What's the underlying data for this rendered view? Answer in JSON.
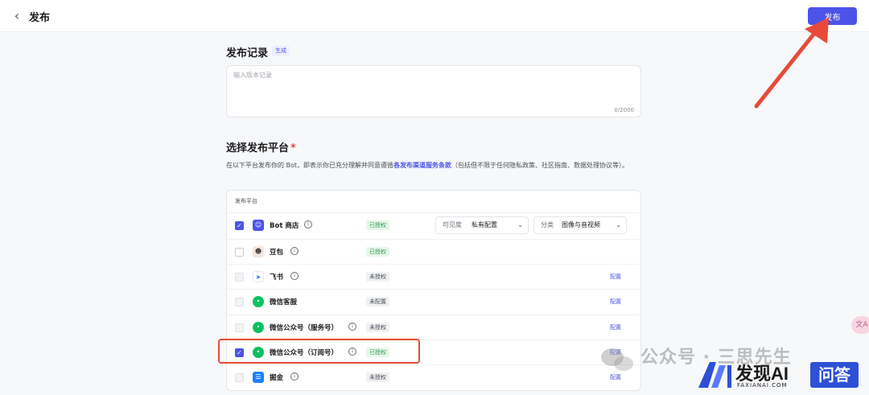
{
  "header": {
    "back_icon": "chevron-left-icon",
    "title": "发布",
    "publish_label": "发布",
    "accent": "#4d53e8"
  },
  "record": {
    "title": "发布记录",
    "generate_label": "生成",
    "placeholder": "输入版本记录",
    "value": "",
    "counter": "0/2000"
  },
  "platforms_section": {
    "title": "选择发布平台",
    "required_mark": "*",
    "desc_before": "在以下平台发布你的 Bot，即表示你已充分理解并同意遵循",
    "desc_link": "各发布渠道服务条款",
    "desc_after": "（包括但不限于任何隐私政策、社区指南、数据处理协议等）。",
    "table_header": "发布平台"
  },
  "rows": [
    {
      "name": "Bot 商店",
      "icon": "bot-store-icon",
      "checked": true,
      "disabled": false,
      "has_info": true,
      "status": "已授权",
      "status_type": "auth",
      "config": "",
      "visibility_label": "可见度",
      "visibility_value": "私有配置",
      "category_label": "分类",
      "category_value": "图像与音视频"
    },
    {
      "name": "豆包",
      "icon": "doubao-icon",
      "checked": false,
      "disabled": false,
      "has_info": true,
      "status": "已授权",
      "status_type": "auth",
      "config": ""
    },
    {
      "name": "飞书",
      "icon": "feishu-icon",
      "checked": false,
      "disabled": true,
      "has_info": true,
      "status": "未授权",
      "status_type": "unauth",
      "config": "配置"
    },
    {
      "name": "微信客服",
      "icon": "wechat-icon",
      "checked": false,
      "disabled": true,
      "has_info": false,
      "status": "未配置",
      "status_type": "unauth",
      "config": "配置"
    },
    {
      "name": "微信公众号（服务号）",
      "icon": "wechat-icon",
      "checked": false,
      "disabled": true,
      "has_info": true,
      "status": "未授权",
      "status_type": "unauth",
      "config": "配置"
    },
    {
      "name": "微信公众号（订阅号）",
      "icon": "wechat-icon",
      "checked": true,
      "disabled": false,
      "has_info": true,
      "status": "已授权",
      "status_type": "auth",
      "config": "配置"
    },
    {
      "name": "掘金",
      "icon": "juejin-icon",
      "checked": false,
      "disabled": true,
      "has_info": true,
      "status": "未授权",
      "status_type": "unauth",
      "config": "配置"
    }
  ],
  "floating": {
    "icon": "translate-icon",
    "label": "文A"
  },
  "watermark": {
    "text": "公众号 · 三思先生",
    "brand": "发现AI",
    "brand_sub": "FAXIANAI.COM",
    "ask": "问答"
  }
}
